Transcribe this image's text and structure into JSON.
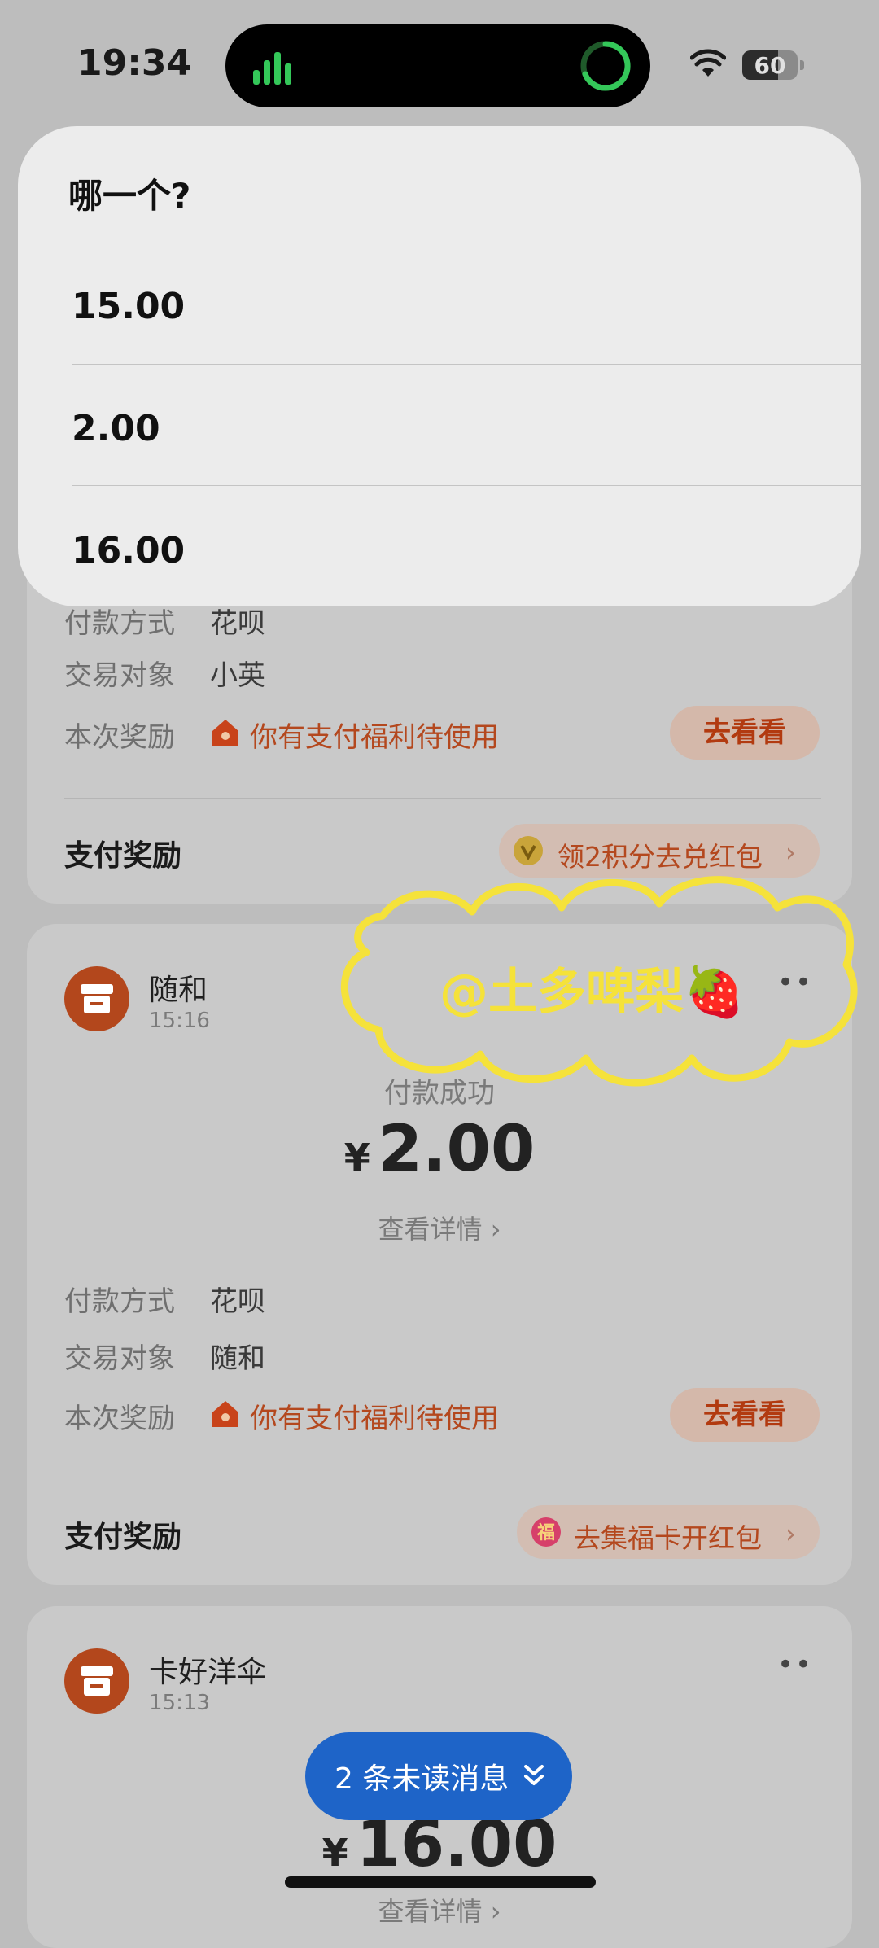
{
  "status_bar": {
    "time": "19:34",
    "battery": "60"
  },
  "action_sheet": {
    "title": "哪一个?",
    "options": [
      "15.00",
      "2.00",
      "16.00"
    ]
  },
  "card1": {
    "payment_method_label": "付款方式",
    "payment_method_value": "花呗",
    "counterparty_label": "交易对象",
    "counterparty_value": "小英",
    "reward_label": "本次奖励",
    "reward_text": "你有支付福利待使用",
    "reward_button": "去看看",
    "section_title": "支付奖励",
    "promo_text": "领2积分去兑红包"
  },
  "card2": {
    "merchant": "随和",
    "time": "15:16",
    "status": "付款成功",
    "currency": "¥",
    "amount": "2.00",
    "details_link": "查看详情",
    "payment_method_label": "付款方式",
    "payment_method_value": "花呗",
    "counterparty_label": "交易对象",
    "counterparty_value": "随和",
    "reward_label": "本次奖励",
    "reward_text": "你有支付福利待使用",
    "reward_button": "去看看",
    "section_title": "支付奖励",
    "promo_text": "去集福卡开红包"
  },
  "card3": {
    "merchant": "卡好洋伞",
    "time": "15:13",
    "currency": "¥",
    "amount": "16.00",
    "details_link": "查看详情"
  },
  "unread_pill": {
    "text": "2 条未读消息"
  },
  "watermark": {
    "text": "@土多啤梨🍓"
  },
  "colors": {
    "accent_orange": "#b4481e",
    "button_blue": "#1e64c8",
    "watermark_yellow": "#f5e23a",
    "signal_green": "#34c759"
  }
}
